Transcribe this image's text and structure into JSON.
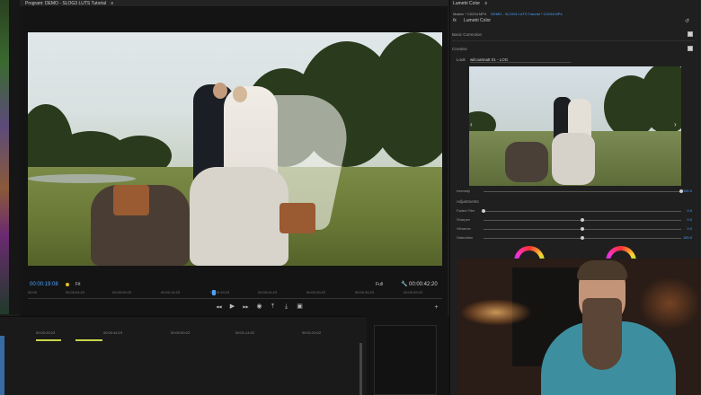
{
  "program_monitor": {
    "title": "Program: DEMO - SLOG3 LUTS Tutorial",
    "timecode_current": "00:00:19:08",
    "timecode_total": "00:00:42:20",
    "fit": "Fit",
    "resolution": "Full",
    "ruler_ticks": [
      "00:00",
      "00:00:04:23",
      "00:00:09:23",
      "00:00:14:23",
      "00:00:19:23",
      "00:00:24:23",
      "00:00:29:23",
      "00:00:34:23",
      "00:00:39:23"
    ],
    "transport": {
      "mark_in": "◆",
      "step_back": "◀◀",
      "play": "▶",
      "step_fwd": "▶▶",
      "camera": "◉",
      "lift": "⤒",
      "extract": "⤓",
      "compare": "▣",
      "add": "+"
    }
  },
  "timeline": {
    "ticks": [
      "00:00:29:23",
      "00:00:44:23",
      "00:00:59:22",
      "00:01:14:22",
      "00:01:29:22"
    ]
  },
  "lumetri": {
    "title": "Lumetri Color",
    "source_path": "Master * C0234.MP4",
    "sequence_path": "DEMO - SLOG3 LUTS Tutorial * C0234.MP4",
    "fx_label": "fx",
    "effect_name": "Lumetri Color",
    "sections": {
      "basic_correction": "Basic Correction",
      "creative": "Creative"
    },
    "look": {
      "label": "Look",
      "value": "wilcoatmatt 01 - LOG"
    },
    "intensity": {
      "label": "Intensity",
      "value": "100.0",
      "fraction": 1.0
    },
    "adjustments_label": "Adjustments",
    "sliders": [
      {
        "label": "Faded Film",
        "value": "0.0",
        "fraction": 0.0
      },
      {
        "label": "Sharpen",
        "value": "0.0",
        "fraction": 0.5
      },
      {
        "label": "Vibrance",
        "value": "0.0",
        "fraction": 0.5
      },
      {
        "label": "Saturation",
        "value": "100.0",
        "fraction": 0.5
      }
    ],
    "accent_color": "#4aa3ff"
  },
  "icons": {
    "close": "✕",
    "menu": "≡",
    "reset": "↺",
    "left_arrow": "‹",
    "right_arrow": "›",
    "wrench": "🔧"
  }
}
